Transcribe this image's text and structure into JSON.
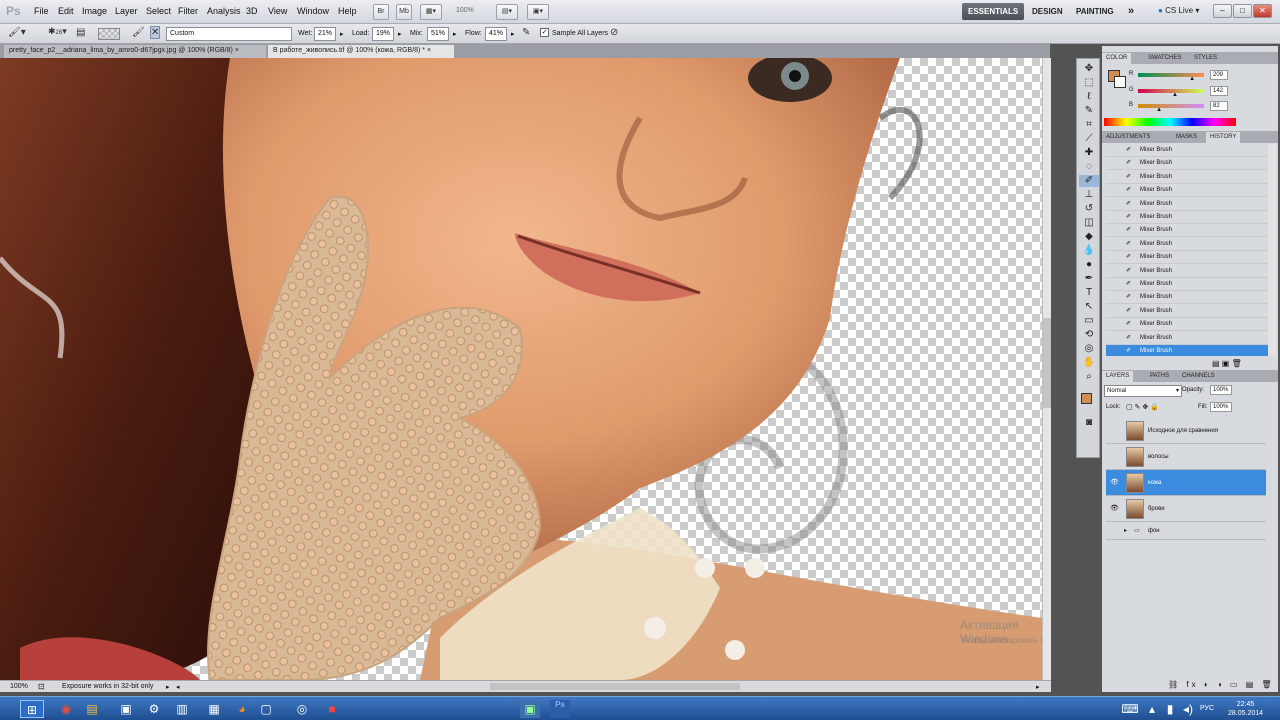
{
  "app": {
    "logo": "Ps"
  },
  "menu": [
    "File",
    "Edit",
    "Image",
    "Layer",
    "Select",
    "Filter",
    "Analysis",
    "3D",
    "View",
    "Window",
    "Help"
  ],
  "menubar": {
    "zoom_value": "100%",
    "workspaces": [
      "ESSENTIALS",
      "DESIGN",
      "PAINTING"
    ],
    "more": "»",
    "cs_live": "CS Live"
  },
  "options": {
    "brush_preset": "Custom",
    "wet_label": "Wet:",
    "wet": "21%",
    "load_label": "Load:",
    "load": "19%",
    "mix_label": "Mix:",
    "mix": "51%",
    "flow_label": "Flow:",
    "flow": "41%",
    "sample_all": "Sample All Layers"
  },
  "tabs": [
    {
      "label": "pretty_face_p2__adriana_lima_by_amro0-d67jpgx.jpg @ 100% (RGB/8)",
      "close": "×"
    },
    {
      "label": "В работе_живопись.tif @ 100% (кожа, RGB/8) *",
      "close": "×"
    }
  ],
  "status": {
    "zoom": "100%",
    "message": "Exposure works in 32-bit only"
  },
  "color_panel": {
    "tabs": [
      "COLOR",
      "SWATCHES",
      "STYLES"
    ],
    "channels": [
      {
        "label": "R",
        "value": "209",
        "pos": 0.82
      },
      {
        "label": "G",
        "value": "142",
        "pos": 0.56
      },
      {
        "label": "B",
        "value": "82",
        "pos": 0.32
      }
    ],
    "foreground": "#d18e52"
  },
  "history_panel": {
    "tabs": [
      "ADJUSTMENTS",
      "MASKS",
      "HISTORY"
    ],
    "items": [
      "Mixer Brush",
      "Mixer Brush",
      "Mixer Brush",
      "Mixer Brush",
      "Mixer Brush",
      "Mixer Brush",
      "Mixer Brush",
      "Mixer Brush",
      "Mixer Brush",
      "Mixer Brush",
      "Mixer Brush",
      "Mixer Brush",
      "Mixer Brush",
      "Mixer Brush",
      "Mixer Brush",
      "Mixer Brush"
    ],
    "selected_index": 15
  },
  "layers_panel": {
    "tabs": [
      "LAYERS",
      "PATHS",
      "CHANNELS"
    ],
    "blend_mode": "Normal",
    "opacity_label": "Opacity:",
    "opacity": "100%",
    "lock_label": "Lock:",
    "fill_label": "Fill:",
    "fill": "100%",
    "layers": [
      {
        "name": "Исходное для сравнения",
        "visible": false
      },
      {
        "name": "волосы",
        "visible": false
      },
      {
        "name": "кожа",
        "visible": true,
        "selected": true
      },
      {
        "name": "брови",
        "visible": true
      },
      {
        "name": "фон",
        "visible": false,
        "group": true
      }
    ]
  },
  "watermark": {
    "title": "Активация Windows",
    "subtitle": "Чтобы активировать Windows, перейдите к параметрам"
  },
  "taskbar": {
    "language": "РУС",
    "time": "22:45",
    "date": "28.05.2014"
  }
}
